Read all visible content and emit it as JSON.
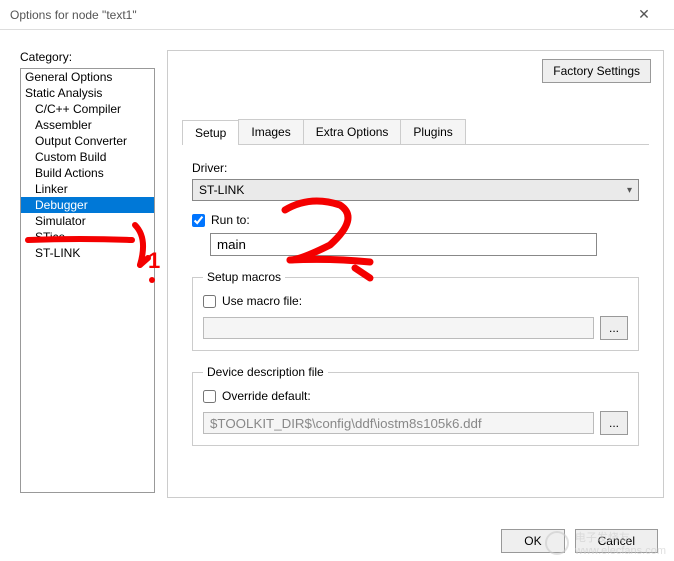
{
  "window": {
    "title": "Options for node \"text1\""
  },
  "left": {
    "label": "Category:",
    "items": [
      {
        "label": "General Options",
        "indent": false,
        "selected": false
      },
      {
        "label": "Static Analysis",
        "indent": false,
        "selected": false
      },
      {
        "label": "C/C++ Compiler",
        "indent": true,
        "selected": false
      },
      {
        "label": "Assembler",
        "indent": true,
        "selected": false
      },
      {
        "label": "Output Converter",
        "indent": true,
        "selected": false
      },
      {
        "label": "Custom Build",
        "indent": true,
        "selected": false
      },
      {
        "label": "Build Actions",
        "indent": true,
        "selected": false
      },
      {
        "label": "Linker",
        "indent": true,
        "selected": false
      },
      {
        "label": "Debugger",
        "indent": true,
        "selected": true
      },
      {
        "label": "Simulator",
        "indent": true,
        "selected": false
      },
      {
        "label": "STice",
        "indent": true,
        "selected": false
      },
      {
        "label": "ST-LINK",
        "indent": true,
        "selected": false
      }
    ]
  },
  "right": {
    "factory_btn": "Factory Settings",
    "tabs": [
      {
        "label": "Setup",
        "active": true
      },
      {
        "label": "Images",
        "active": false
      },
      {
        "label": "Extra Options",
        "active": false
      },
      {
        "label": "Plugins",
        "active": false
      }
    ],
    "driver": {
      "label": "Driver:",
      "value": "ST-LINK"
    },
    "runto": {
      "label": "Run to:",
      "checked": true,
      "value": "main"
    },
    "macros": {
      "legend": "Setup macros",
      "use_label": "Use macro file:",
      "checked": false,
      "file": "",
      "browse": "..."
    },
    "ddf": {
      "legend": "Device description file",
      "override_label": "Override default:",
      "checked": false,
      "file": "$TOOLKIT_DIR$\\config\\ddf\\iostm8s105k6.ddf",
      "browse": "..."
    }
  },
  "footer": {
    "ok": "OK",
    "cancel": "Cancel"
  },
  "watermark": {
    "text": "电子发烧友",
    "url": "www.elecfans.com"
  }
}
